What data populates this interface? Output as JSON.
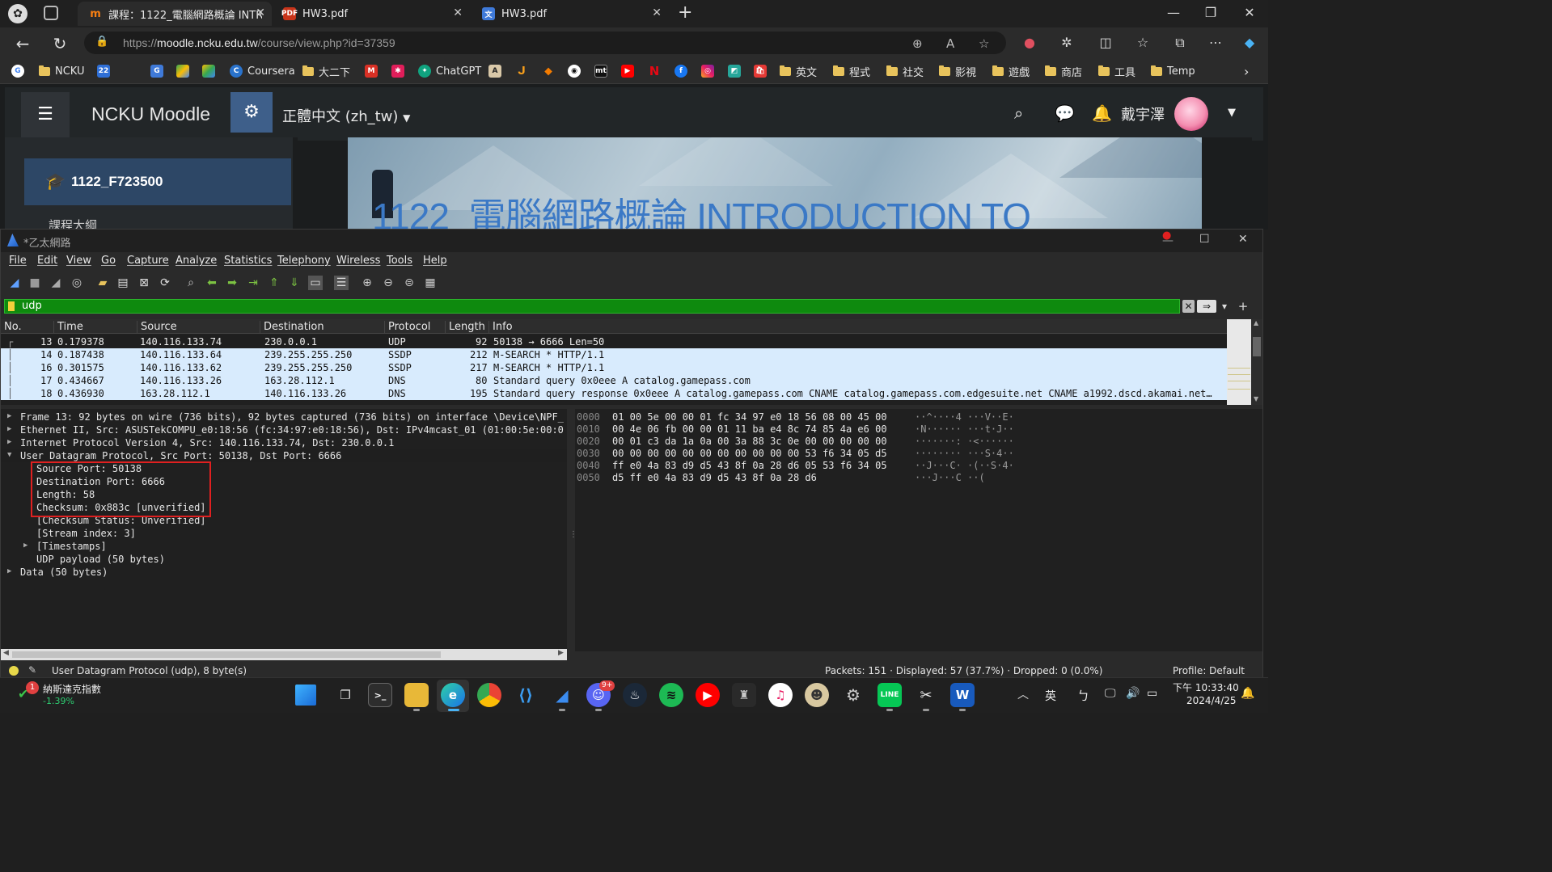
{
  "browser": {
    "tabs": [
      {
        "label": "課程：1122_電腦網路概論 INTRO",
        "icon": "moodle-tab-icon",
        "active": true
      },
      {
        "label": "HW3.pdf",
        "icon": "pdf-tab-icon",
        "active": false
      },
      {
        "label": "HW3.pdf",
        "icon": "translate-pdf-tab-icon",
        "active": false
      }
    ],
    "url_prefix": "https://",
    "url_host": "moodle.ncku.edu.tw",
    "url_path": "/course/view.php?id=37359",
    "bookmarks": [
      "NCKU",
      "Coursera",
      "大二下",
      "ChatGPT",
      "英文",
      "程式",
      "社交",
      "影視",
      "遊戲",
      "商店",
      "工具",
      "Temp"
    ]
  },
  "moodle": {
    "brand": "NCKU Moodle",
    "language": "正體中文 (zh_tw)",
    "user_name": "戴宇澤",
    "course_code": "1122_F723500",
    "banner_title": "1122_電腦網路概論 INTRODUCTION TO",
    "side_item_partial": "課程大綱"
  },
  "wireshark": {
    "window_title": "*乙太網路",
    "menu": [
      "File",
      "Edit",
      "View",
      "Go",
      "Capture",
      "Analyze",
      "Statistics",
      "Telephony",
      "Wireless",
      "Tools",
      "Help"
    ],
    "filter": "udp",
    "columns": [
      "No.",
      "Time",
      "Source",
      "Destination",
      "Protocol",
      "Length",
      "Info"
    ],
    "packets": [
      {
        "no": "13",
        "time": "0.179378",
        "src": "140.116.133.74",
        "dst": "230.0.0.1",
        "proto": "UDP",
        "len": "92",
        "info": "50138 → 6666 Len=50",
        "selected": true
      },
      {
        "no": "14",
        "time": "0.187438",
        "src": "140.116.133.64",
        "dst": "239.255.255.250",
        "proto": "SSDP",
        "len": "212",
        "info": "M-SEARCH * HTTP/1.1"
      },
      {
        "no": "16",
        "time": "0.301575",
        "src": "140.116.133.62",
        "dst": "239.255.255.250",
        "proto": "SSDP",
        "len": "217",
        "info": "M-SEARCH * HTTP/1.1"
      },
      {
        "no": "17",
        "time": "0.434667",
        "src": "140.116.133.26",
        "dst": "163.28.112.1",
        "proto": "DNS",
        "len": "80",
        "info": "Standard query 0x0eee A catalog.gamepass.com"
      },
      {
        "no": "18",
        "time": "0.436930",
        "src": "163.28.112.1",
        "dst": "140.116.133.26",
        "proto": "DNS",
        "len": "195",
        "info": "Standard query response 0x0eee A catalog.gamepass.com CNAME catalog.gamepass.com.edgesuite.net CNAME a1992.dscd.akamai.net…"
      }
    ],
    "details": [
      {
        "text": "Frame 13: 92 bytes on wire (736 bits), 92 bytes captured (736 bits) on interface \\Device\\NPF_",
        "arrow": "▶",
        "indent": 0
      },
      {
        "text": "Ethernet II, Src: ASUSTekCOMPU_e0:18:56 (fc:34:97:e0:18:56), Dst: IPv4mcast_01 (01:00:5e:00:0",
        "arrow": "▶",
        "indent": 0
      },
      {
        "text": "Internet Protocol Version 4, Src: 140.116.133.74, Dst: 230.0.0.1",
        "arrow": "▶",
        "indent": 0
      },
      {
        "text": "User Datagram Protocol, Src Port: 50138, Dst Port: 6666",
        "arrow": "▼",
        "indent": 0
      },
      {
        "text": "Source Port: 50138",
        "arrow": "",
        "indent": 1
      },
      {
        "text": "Destination Port: 6666",
        "arrow": "",
        "indent": 1
      },
      {
        "text": "Length: 58",
        "arrow": "",
        "indent": 1
      },
      {
        "text": "Checksum: 0x883c [unverified]",
        "arrow": "",
        "indent": 1
      },
      {
        "text": "[Checksum Status: Unverified]",
        "arrow": "",
        "indent": 1
      },
      {
        "text": "[Stream index: 3]",
        "arrow": "",
        "indent": 1
      },
      {
        "text": "[Timestamps]",
        "arrow": "▶",
        "indent": 1
      },
      {
        "text": "UDP payload (50 bytes)",
        "arrow": "",
        "indent": 1
      },
      {
        "text": "Data (50 bytes)",
        "arrow": "▶",
        "indent": 0
      }
    ],
    "bytes": [
      {
        "off": "0000",
        "hex": "01 00 5e 00 00 01 fc 34  97 e0 18 56 08 00 45 00",
        "ascii": "··^····4 ···V··E·"
      },
      {
        "off": "0010",
        "hex": "00 4e 06 fb 00 00 01 11  ba e4 8c 74 85 4a e6 00",
        "ascii": "·N······ ···t·J··"
      },
      {
        "off": "0020",
        "hex": "00 01 c3 da 1a 0a 00 3a  88 3c 0e 00 00 00 00 00",
        "ascii": "·······: ·<······"
      },
      {
        "off": "0030",
        "hex": "00 00 00 00 00 00 00 00  00 00 00 53 f6 34 05 d5",
        "ascii": "········ ···S·4··"
      },
      {
        "off": "0040",
        "hex": "ff e0 4a 83 d9 d5 43 8f  0a 28 d6 05 53 f6 34 05",
        "ascii": "··J···C· ·(··S·4·"
      },
      {
        "off": "0050",
        "hex": "d5 ff e0 4a 83 d9 d5 43  8f 0a 28 d6",
        "ascii": "···J···C ··("
      }
    ],
    "status_left": "User Datagram Protocol (udp), 8 byte(s)",
    "status_mid": "Packets: 151 · Displayed: 57 (37.7%) · Dropped: 0 (0.0%)",
    "status_right": "Profile: Default"
  },
  "taskbar": {
    "stock_name": "納斯達克指數",
    "stock_change": "-1.39%",
    "stock_badge": "1",
    "discord_badge": "9+",
    "ime": "英",
    "time": "下午 10:33:40",
    "date": "2024/4/25"
  }
}
